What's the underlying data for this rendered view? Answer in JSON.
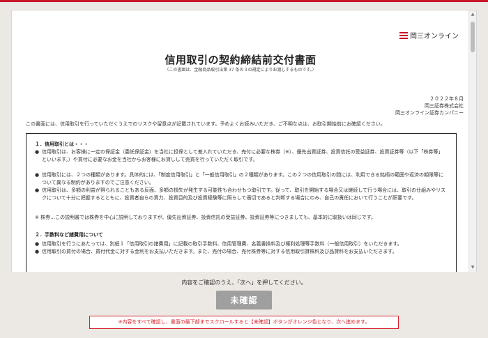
{
  "brand": {
    "logo_text": "岡三オンライン",
    "accent_color": "#c8162c"
  },
  "document": {
    "title": "信用取引の契約締結前交付書面",
    "subtitle": "（この書面は、金融商品取引法第 37 条の３の規定によりお渡しするものです。）",
    "issuer_date": "２０２２年８月",
    "issuer_company": "岡三証券株式会社",
    "issuer_division": "岡三オンライン証券カンパニー",
    "intro": "この書面には、信用取引を行っていただくうえでのリスクや留意点が記載されています。予めよくお読みいただき、ご不明な点は、お取引開始前にお確認ください。",
    "section1": {
      "heading": "１．信用取引とは・・・",
      "items": [
        "信用取引は、お客様に一定の保証金（委託保証金）を当社に担保として差入れていただき、売付に必要な株券（※）、優先出資証券、投資信託の受益証券、投資証券等（以下「株券等」といいます。）や買付に必要なお金を当社からお客様にお貸しして売買を行っていただく取引です。",
        "信用取引には、２つの種類があります。具体的には、「制度信用取引」と「一般信用取引」の２種類があります。この２つの信用取引の間には、利用できる銘柄の範囲や返済の期限等について異なる制約がありますのでご注意ください。",
        "信用取引は、多額の利益が得られることもある反面、多額の損失が発生する可能性も合わせもつ取引です。従って、取引を開始する場合又は継続して行う場合には、取引の仕組みやリスクについて十分に把握するとともに、投資者自らの資力、投資目的及び投資経験等に照らして適切であると判断する場合にのみ、自己の責任において行うことが肝要です。"
      ],
      "note": "※ 株券…この説明書では株券を中心に説明しておりますが、優先出資証券、投資信託の受益証券、投資証券等につきましても、基本的に取扱いは同じです。"
    },
    "section2": {
      "heading": "２．手数料など諸費用について",
      "items": [
        "信用取引を行うにあたっては、別紙１「信用取引の諸費用」に記載の取引手数料、信用管理費、名義書換料及び権利処理等手数料（一般信用取引）をいただきます。",
        "信用取引の買付の場合、買付代金に対する金利をお支払いただきます。また、売付の場合、売付株券等に対する信用取引貸株料及び品貸料をお支払いただきます。"
      ]
    }
  },
  "footer": {
    "instruction": "内容をご確認のうえ、「次へ」を押してください。",
    "button_label": "未確認",
    "notice": "※内容をすべて確認し、書面の最下部までスクロールすると【未確認】ボタンがオレンジ色となり、次へ進めます。",
    "button_color": "#9f9f9f",
    "notice_color": "#d8222a"
  }
}
